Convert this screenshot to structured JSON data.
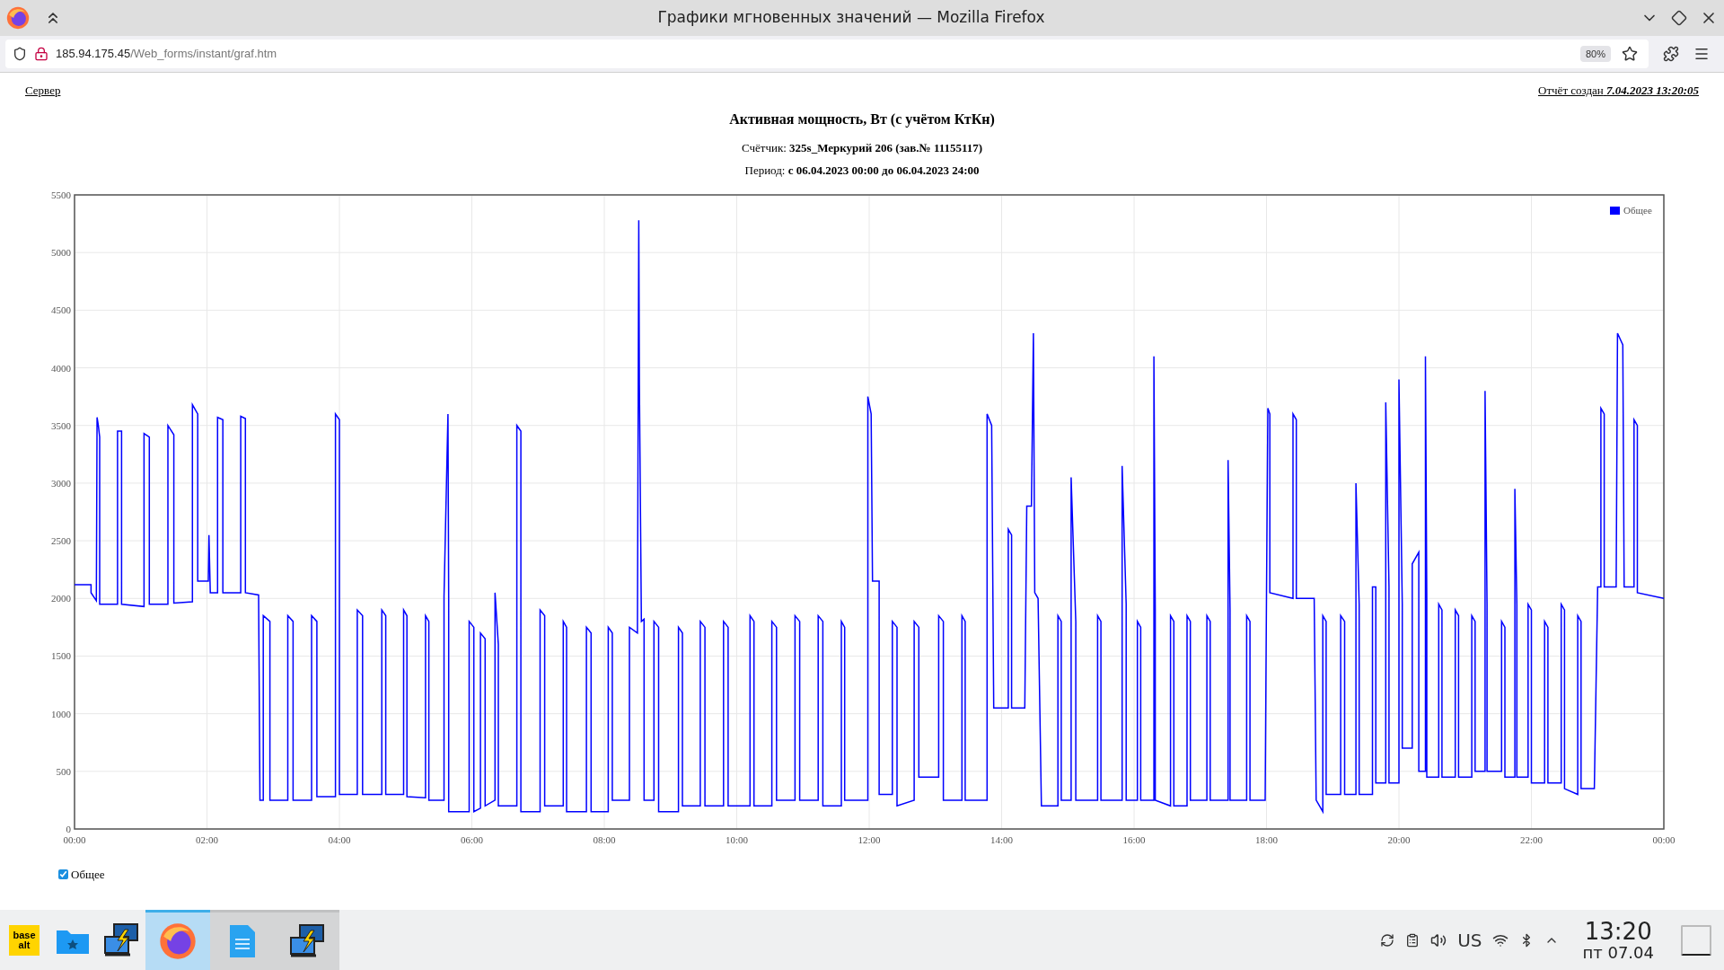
{
  "window": {
    "title": "Графики мгновенных значений — Mozilla Firefox"
  },
  "toolbar": {
    "url_host": "185.94.175.45",
    "url_path": "/Web_forms/instant/graf.htm",
    "zoom": "80%"
  },
  "page": {
    "server_link": "Сервер",
    "report_label": "Отчёт создан",
    "report_time": "7.04.2023 13:20:05",
    "title": "Активная мощность, Вт (с учётом КтКн)",
    "meter": "Счётчик: **325s_Меркурий 206 (зав.№ 11155117)**",
    "period": "Период: **с 06.04.2023 00:00 до 06.04.2023 24:00**",
    "chart_data": {
      "type": "line",
      "grid": true,
      "xlim": [
        0,
        24
      ],
      "ylim": [
        0,
        5500
      ],
      "xticks": [
        {
          "value": 0,
          "label": "00:00"
        },
        {
          "value": 2,
          "label": "02:00"
        },
        {
          "value": 4,
          "label": "04:00"
        },
        {
          "value": 6,
          "label": "06:00"
        },
        {
          "value": 8,
          "label": "08:00"
        },
        {
          "value": 10,
          "label": "10:00"
        },
        {
          "value": 12,
          "label": "12:00"
        },
        {
          "value": 14,
          "label": "14:00"
        },
        {
          "value": 16,
          "label": "16:00"
        },
        {
          "value": 18,
          "label": "18:00"
        },
        {
          "value": 20,
          "label": "20:00"
        },
        {
          "value": 22,
          "label": "22:00"
        },
        {
          "value": 24,
          "label": "00:00"
        }
      ],
      "yticks": [
        0,
        500,
        1000,
        1500,
        2000,
        2500,
        3000,
        3500,
        4000,
        4500,
        5000,
        5500
      ],
      "x": [
        0,
        0.25,
        0.25,
        0.33,
        0.34,
        0.36,
        0.38,
        0.38,
        0.65,
        0.65,
        0.71,
        0.71,
        1.05,
        1.05,
        1.13,
        1.13,
        1.41,
        1.41,
        1.5,
        1.5,
        1.78,
        1.78,
        1.86,
        1.86,
        2.02,
        2.03,
        2.05,
        2.16,
        2.16,
        2.24,
        2.24,
        2.51,
        2.51,
        2.58,
        2.58,
        2.78,
        2.8,
        2.85,
        2.85,
        2.95,
        2.95,
        3.22,
        3.22,
        3.3,
        3.3,
        3.58,
        3.58,
        3.66,
        3.66,
        3.94,
        3.94,
        4.0,
        4.0,
        4.27,
        4.27,
        4.35,
        4.35,
        4.64,
        4.64,
        4.7,
        4.7,
        4.97,
        4.97,
        5.02,
        5.02,
        5.3,
        5.3,
        5.35,
        5.35,
        5.58,
        5.58,
        5.64,
        5.65,
        5.65,
        5.96,
        5.96,
        6.03,
        6.03,
        6.13,
        6.13,
        6.2,
        6.2,
        6.35,
        6.35,
        6.4,
        6.4,
        6.68,
        6.68,
        6.74,
        6.74,
        7.03,
        7.03,
        7.1,
        7.1,
        7.38,
        7.38,
        7.43,
        7.43,
        7.73,
        7.73,
        7.8,
        7.8,
        8.06,
        8.06,
        8.12,
        8.12,
        8.38,
        8.38,
        8.5,
        8.52,
        8.53,
        8.56,
        8.6,
        8.6,
        8.75,
        8.75,
        8.82,
        8.82,
        9.12,
        9.12,
        9.18,
        9.18,
        9.45,
        9.45,
        9.52,
        9.52,
        9.8,
        9.8,
        9.87,
        9.87,
        10.2,
        10.2,
        10.26,
        10.26,
        10.53,
        10.53,
        10.6,
        10.6,
        10.88,
        10.88,
        10.95,
        10.95,
        11.23,
        11.23,
        11.3,
        11.3,
        11.58,
        11.58,
        11.63,
        11.63,
        11.98,
        11.98,
        12.03,
        12.05,
        12.15,
        12.15,
        12.35,
        12.35,
        12.42,
        12.42,
        12.68,
        12.68,
        12.75,
        12.75,
        13.05,
        13.05,
        13.12,
        13.12,
        13.4,
        13.4,
        13.45,
        13.45,
        13.78,
        13.78,
        13.85,
        13.88,
        14.1,
        14.1,
        14.15,
        14.15,
        14.35,
        14.38,
        14.45,
        14.48,
        14.5,
        14.55,
        14.6,
        14.85,
        14.85,
        14.9,
        14.9,
        15.05,
        15.05,
        15.12,
        15.12,
        15.45,
        15.45,
        15.5,
        15.5,
        15.82,
        15.82,
        15.88,
        15.88,
        16.05,
        16.05,
        16.1,
        16.1,
        16.3,
        16.3,
        16.32,
        16.32,
        16.55,
        16.55,
        16.6,
        16.6,
        16.8,
        16.8,
        16.85,
        16.85,
        17.1,
        17.1,
        17.15,
        17.15,
        17.42,
        17.42,
        17.45,
        17.45,
        17.7,
        17.7,
        17.75,
        17.75,
        17.98,
        18.0,
        18.02,
        18.05,
        18.05,
        18.4,
        18.4,
        18.45,
        18.45,
        18.72,
        18.75,
        18.85,
        18.85,
        18.9,
        18.9,
        19.12,
        19.12,
        19.18,
        19.18,
        19.35,
        19.35,
        19.4,
        19.4,
        19.6,
        19.6,
        19.65,
        19.65,
        19.8,
        19.8,
        19.85,
        19.85,
        20.0,
        20.0,
        20.05,
        20.05,
        20.2,
        20.2,
        20.3,
        20.3,
        20.4,
        20.4,
        20.42,
        20.42,
        20.6,
        20.6,
        20.65,
        20.65,
        20.85,
        20.85,
        20.9,
        20.9,
        21.1,
        21.1,
        21.15,
        21.15,
        21.3,
        21.3,
        21.33,
        21.33,
        21.55,
        21.55,
        21.6,
        21.6,
        21.75,
        21.75,
        21.78,
        21.78,
        21.95,
        21.95,
        22.0,
        22.0,
        22.2,
        22.2,
        22.25,
        22.25,
        22.45,
        22.45,
        22.5,
        22.5,
        22.7,
        22.7,
        22.75,
        22.75,
        22.95,
        23.0,
        23.05,
        23.05,
        23.1,
        23.1,
        23.28,
        23.3,
        23.38,
        23.4,
        23.55,
        23.55,
        23.6,
        23.6,
        24
      ],
      "series": [
        {
          "name": "Общее",
          "color": "#0000ff",
          "values": [
            2120,
            2120,
            2050,
            1980,
            3570,
            3500,
            3400,
            1950,
            1950,
            3450,
            3450,
            1950,
            1930,
            3430,
            3400,
            1950,
            1950,
            3500,
            3420,
            1960,
            1970,
            3680,
            3600,
            2150,
            2150,
            2550,
            2050,
            2050,
            3570,
            3550,
            2050,
            2050,
            3580,
            3560,
            2050,
            2030,
            250,
            250,
            1850,
            1800,
            250,
            250,
            1850,
            1800,
            250,
            250,
            1850,
            1800,
            280,
            280,
            3600,
            3550,
            300,
            300,
            1900,
            1850,
            300,
            300,
            1900,
            1850,
            300,
            300,
            1900,
            1850,
            280,
            270,
            1850,
            1800,
            250,
            250,
            2020,
            3600,
            2000,
            150,
            150,
            1800,
            1750,
            150,
            180,
            1700,
            1650,
            200,
            250,
            2050,
            1600,
            200,
            200,
            3500,
            3450,
            150,
            150,
            1900,
            1850,
            200,
            200,
            1800,
            1750,
            150,
            150,
            1750,
            1700,
            150,
            150,
            1750,
            1700,
            250,
            250,
            1750,
            1700,
            5280,
            3850,
            1800,
            1820,
            250,
            250,
            1800,
            1750,
            150,
            150,
            1750,
            1700,
            200,
            200,
            1800,
            1750,
            200,
            200,
            1800,
            1750,
            200,
            200,
            1850,
            1800,
            200,
            200,
            1800,
            1750,
            250,
            250,
            1850,
            1800,
            250,
            250,
            1850,
            1800,
            200,
            200,
            1800,
            1750,
            250,
            250,
            3750,
            3600,
            2150,
            2150,
            300,
            300,
            1800,
            1750,
            200,
            250,
            1800,
            1750,
            450,
            450,
            1850,
            1800,
            250,
            250,
            1850,
            1800,
            250,
            250,
            3600,
            3500,
            1050,
            1050,
            2600,
            2550,
            1050,
            1050,
            2800,
            2800,
            4300,
            2050,
            2000,
            200,
            200,
            1850,
            1800,
            250,
            250,
            3050,
            1800,
            250,
            250,
            1850,
            1800,
            250,
            250,
            3150,
            1950,
            250,
            250,
            1800,
            1750,
            250,
            250,
            4100,
            1900,
            250,
            200,
            1850,
            1800,
            200,
            200,
            1850,
            1800,
            250,
            250,
            1850,
            1800,
            250,
            250,
            3200,
            1900,
            250,
            250,
            1850,
            1800,
            250,
            250,
            2050,
            3650,
            3600,
            2050,
            2000,
            3600,
            3550,
            2000,
            2000,
            250,
            150,
            1850,
            1800,
            300,
            300,
            1850,
            1800,
            300,
            300,
            3000,
            1950,
            300,
            300,
            2100,
            2100,
            400,
            400,
            3700,
            2100,
            400,
            400,
            3900,
            1950,
            700,
            700,
            2300,
            2400,
            500,
            500,
            4100,
            2000,
            450,
            450,
            1950,
            1900,
            450,
            450,
            1900,
            1850,
            450,
            450,
            1850,
            1800,
            500,
            500,
            3800,
            1950,
            500,
            500,
            1800,
            1750,
            450,
            450,
            2950,
            1950,
            450,
            450,
            1950,
            1900,
            400,
            400,
            1800,
            1750,
            400,
            400,
            1950,
            1900,
            350,
            300,
            1850,
            1800,
            350,
            350,
            2100,
            2100,
            3650,
            3600,
            2100,
            2100,
            4300,
            4200,
            2100,
            2100,
            3550,
            3500,
            2050,
            2000
          ]
        }
      ]
    },
    "legend": {
      "label": "Общее",
      "checked": true
    }
  },
  "taskbar": {
    "apps": [
      {
        "kind": "logo",
        "lines": [
          "base",
          "alt"
        ],
        "selected": false,
        "open": false
      },
      {
        "kind": "folder",
        "selected": false,
        "open": false
      },
      {
        "kind": "network",
        "selected": false,
        "open": false
      },
      {
        "kind": "firefox",
        "selected": true,
        "open": true
      },
      {
        "kind": "document",
        "selected": false,
        "open": true
      },
      {
        "kind": "network",
        "selected": false,
        "open": true
      }
    ],
    "keyboard": "US",
    "time": "13:20",
    "date": "пт 07.04"
  }
}
